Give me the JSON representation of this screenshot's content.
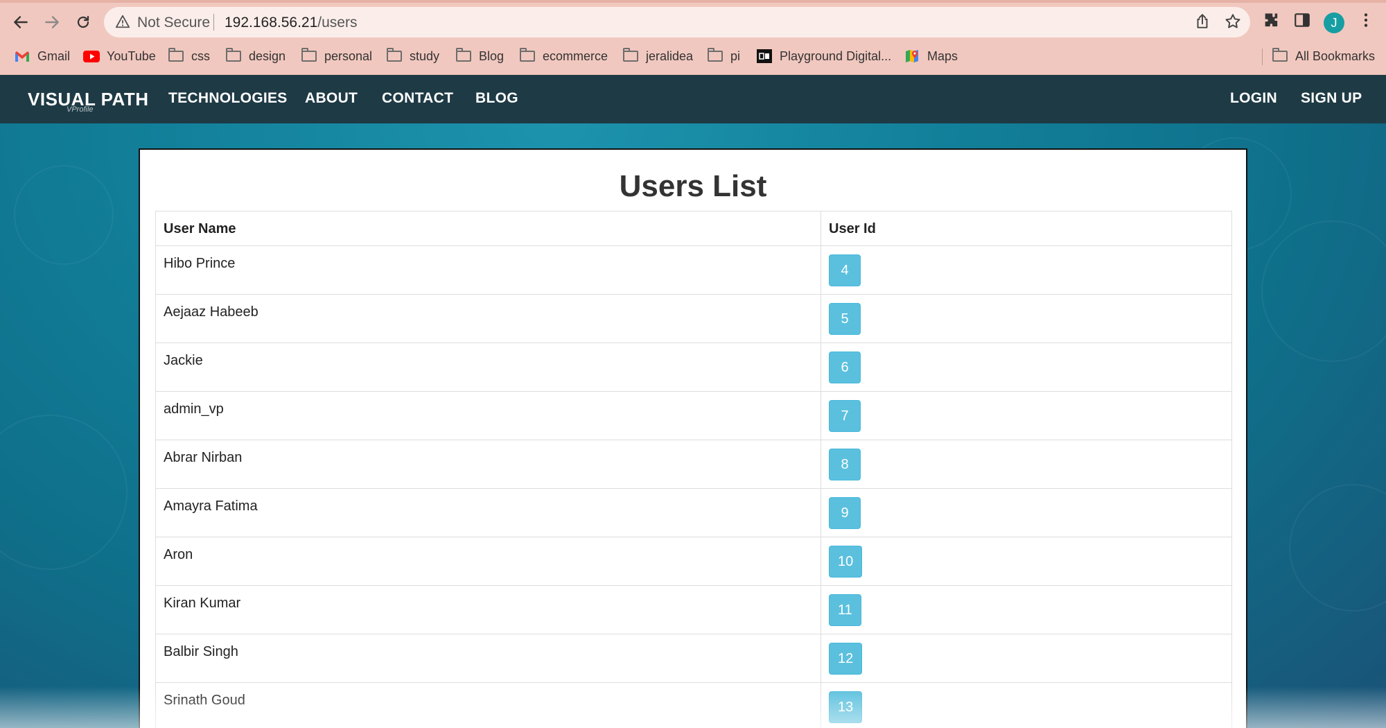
{
  "browser": {
    "security_label": "Not Secure",
    "url_host": "192.168.56.21",
    "url_path": "/users",
    "avatar_initial": "J",
    "bookmarks": [
      {
        "label": "Gmail",
        "icon": "gmail-icon"
      },
      {
        "label": "YouTube",
        "icon": "youtube-icon"
      },
      {
        "label": "css",
        "icon": "folder-icon"
      },
      {
        "label": "design",
        "icon": "folder-icon"
      },
      {
        "label": "personal",
        "icon": "folder-icon"
      },
      {
        "label": "study",
        "icon": "folder-icon"
      },
      {
        "label": "Blog",
        "icon": "folder-icon"
      },
      {
        "label": "ecommerce",
        "icon": "folder-icon"
      },
      {
        "label": "jeralidea",
        "icon": "folder-icon"
      },
      {
        "label": "pi",
        "icon": "folder-icon"
      },
      {
        "label": "Playground Digital...",
        "icon": "playground-icon"
      },
      {
        "label": "Maps",
        "icon": "maps-icon"
      }
    ],
    "all_bookmarks_label": "All Bookmarks"
  },
  "site": {
    "brand": "VISUAL PATH",
    "brand_sub": "VProfile",
    "nav": {
      "technologies": "TECHNOLOGIES",
      "about": "ABOUT",
      "contact": "CONTACT",
      "blog": "BLOG",
      "login": "LOGIN",
      "signup": "SIGN UP"
    }
  },
  "page": {
    "title": "Users List",
    "columns": [
      "User Name",
      "User Id"
    ],
    "users": [
      {
        "name": "Hibo Prince",
        "id": "4"
      },
      {
        "name": "Aejaaz Habeeb",
        "id": "5"
      },
      {
        "name": "Jackie",
        "id": "6"
      },
      {
        "name": "admin_vp",
        "id": "7"
      },
      {
        "name": "Abrar Nirban",
        "id": "8"
      },
      {
        "name": "Amayra Fatima",
        "id": "9"
      },
      {
        "name": "Aron",
        "id": "10"
      },
      {
        "name": "Kiran Kumar",
        "id": "11"
      },
      {
        "name": "Balbir Singh",
        "id": "12"
      },
      {
        "name": "Srinath Goud",
        "id": "13"
      }
    ]
  },
  "colors": {
    "chrome_bg": "#f1c8bf",
    "nav_bg": "#1e3a45",
    "hero_bg": "#127f99",
    "badge_bg": "#5bc0de"
  }
}
